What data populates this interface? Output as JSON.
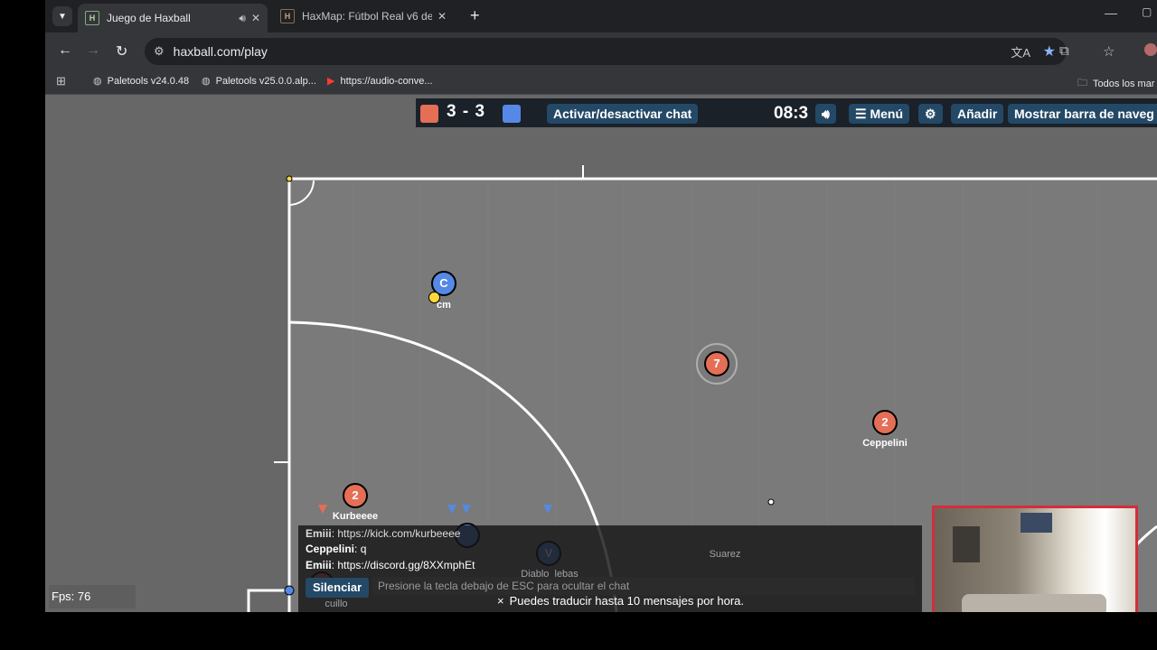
{
  "browser": {
    "tabs": [
      {
        "title": "Juego de Haxball",
        "favicon": "H",
        "active": true
      },
      {
        "title": "HaxMap: Fútbol Real v6 de War",
        "favicon": "H",
        "active": false
      }
    ],
    "url": "haxball.com/play",
    "bookmarks": [
      {
        "label": "Paletools v24.0.48",
        "icon": "globe-icon"
      },
      {
        "label": "Paletools v25.0.0.alp...",
        "icon": "globe-icon"
      },
      {
        "label": "https://audio-conve...",
        "icon": "youtube-icon"
      }
    ],
    "all_bookmarks_label": "Todos los mar"
  },
  "game": {
    "score_red": "3",
    "score_separator": "-",
    "score_blue": "3",
    "red_color": "#e56e56",
    "blue_color": "#5689e5",
    "chat_toggle_label": "Activar/desactivar chat",
    "timer": "08:3",
    "menu_label": "☰ Menú",
    "add_label": "Añadir",
    "navbar_label": "Mostrar barra de naveg",
    "fps_label": "Fps: 76",
    "players": [
      {
        "avatar": "C",
        "name": "cm",
        "team": "blue"
      },
      {
        "avatar": "7",
        "name": "",
        "team": "red"
      },
      {
        "avatar": "2",
        "name": "Ceppelini",
        "team": "red"
      },
      {
        "avatar": "2",
        "name": "Kurbeeee",
        "team": "red"
      },
      {
        "avatar": "",
        "name": "Suarez",
        "team": "blue"
      },
      {
        "avatar": "V",
        "name": "Diablo_lebas",
        "team": "blue"
      },
      {
        "avatar": "",
        "name": "cuillo",
        "team": "red"
      }
    ],
    "chat": {
      "messages": [
        {
          "author": "Emiii",
          "text": "https://kick.com/kurbeeee"
        },
        {
          "author": "Ceppelini",
          "text": "q"
        },
        {
          "author": "Emiii",
          "text": "https://discord.gg/8XXmphEt"
        }
      ],
      "mute_label": "Silenciar",
      "input_placeholder": "Presione la tecla debajo de ESC para ocultar el chat",
      "translate_notice": "Puedes traducir hasta 10 mensajes por hora."
    }
  }
}
